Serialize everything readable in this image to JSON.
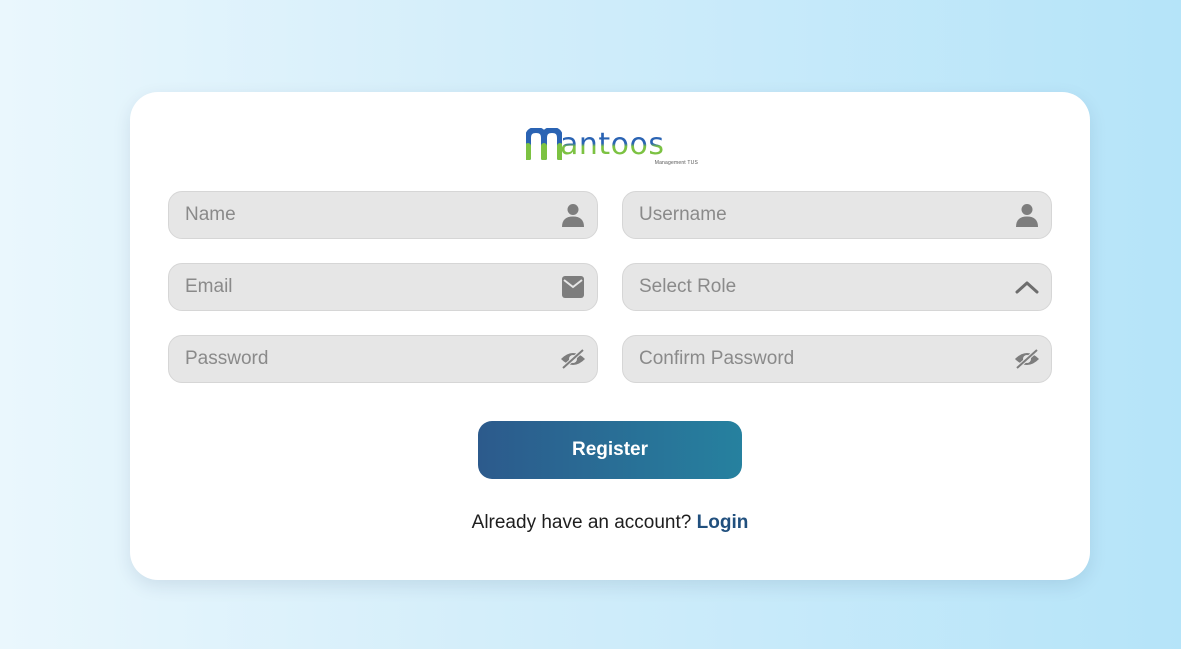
{
  "logo": {
    "brand": "antoos",
    "tagline": "Management TUS"
  },
  "form": {
    "name": {
      "placeholder": "Name",
      "icon": "user-icon"
    },
    "username": {
      "placeholder": "Username",
      "icon": "user-icon"
    },
    "email": {
      "placeholder": "Email",
      "icon": "envelope-icon"
    },
    "role": {
      "placeholder": "Select Role",
      "icon": "chevron-up-icon"
    },
    "password": {
      "placeholder": "Password",
      "icon": "eye-slash-icon"
    },
    "confirm_password": {
      "placeholder": "Confirm Password",
      "icon": "eye-slash-icon"
    }
  },
  "register_button": {
    "label": "Register"
  },
  "footer": {
    "prompt": "Already have an account?",
    "login_label": "Login"
  },
  "colors": {
    "brand_blue": "#2a63b3",
    "brand_green": "#7cc242",
    "button_start": "#2c5a8c",
    "button_end": "#26819f",
    "link": "#21507e"
  }
}
